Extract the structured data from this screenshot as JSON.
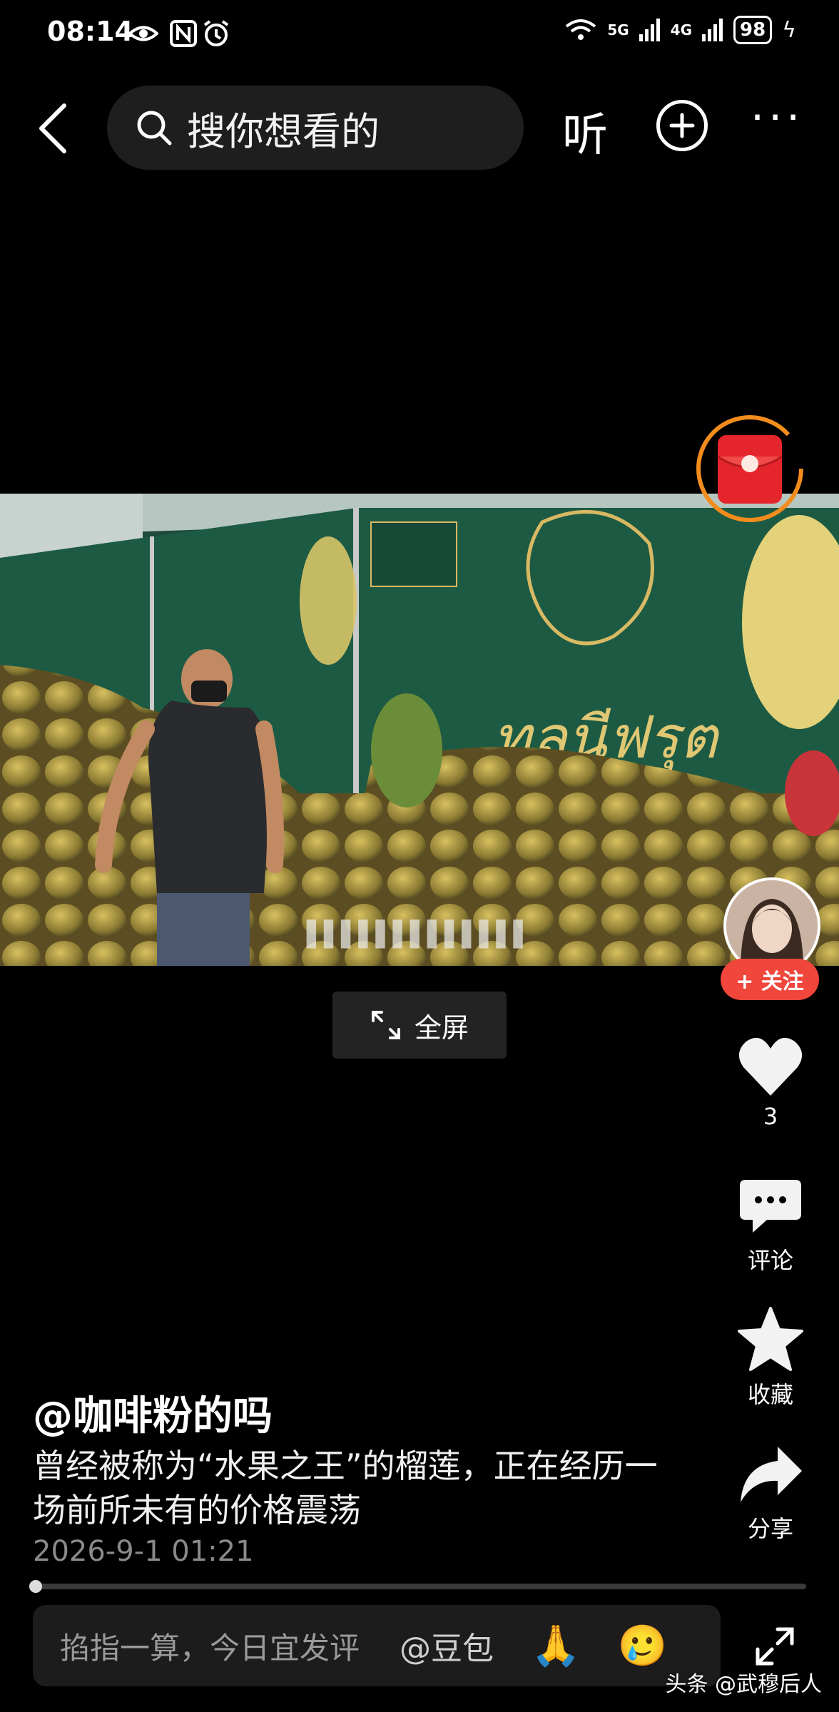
{
  "status_bar": {
    "time": "08:14",
    "signal_5g": "5G",
    "signal_4g": "4G",
    "battery": "98"
  },
  "top_bar": {
    "search_placeholder": "搜你想看的",
    "listen_label": "听"
  },
  "video": {
    "subtitle": "▌▌▌▌▌▌▌▌▌▌▌▌▌",
    "fullscreen_label": "全屏"
  },
  "right_rail": {
    "follow_label": "+ 关注",
    "like_count": "3",
    "comment_label": "评论",
    "favorite_label": "收藏",
    "share_label": "分享"
  },
  "post": {
    "author": "@咖啡粉的吗",
    "description": "曾经被称为“水果之王”的榴莲，正在经历一场前所未有的价格震荡",
    "date": "2026-9-1 01:21",
    "progress_fraction": 0.004
  },
  "comment_bar": {
    "placeholder": "掐指一算，今日宜发评",
    "mention": "@豆包",
    "emoji_1": "🙏",
    "emoji_2": "🥲"
  },
  "watermark": "头条 @武穆后人",
  "colors": {
    "accent_red": "#f0463c",
    "ring_orange": "#f28c1c"
  }
}
